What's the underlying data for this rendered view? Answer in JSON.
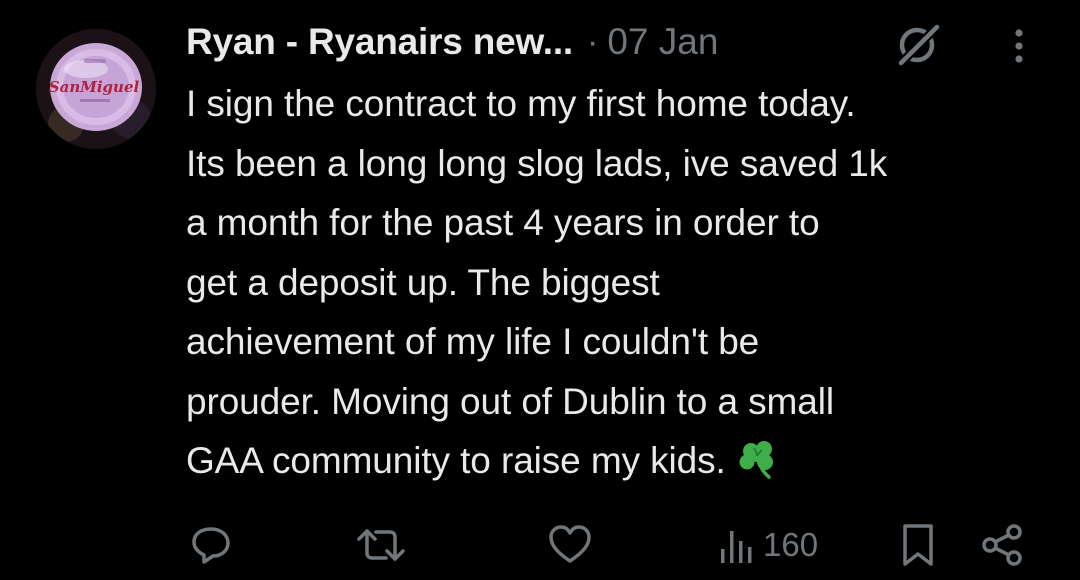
{
  "tweet": {
    "author_name": "Ryan - Ryanairs new...",
    "separator": "·",
    "timestamp": "07 Jan",
    "avatar_logo_text": "SanMiguel",
    "text_lines": [
      "I sign the contract to my first home today.",
      "Its been a long long slog lads, ive saved 1k",
      "a month for the past 4 years in order to",
      "get a deposit up. The biggest",
      "achievement of my life I couldn't be",
      "prouder. Moving out of Dublin to a small",
      "GAA community to raise my kids."
    ],
    "emoji": "shamrock"
  },
  "actions": {
    "reply_icon": "reply-icon",
    "retweet_icon": "retweet-icon",
    "like_icon": "heart-icon",
    "views_icon": "views-icon",
    "views_count": "160",
    "bookmark_icon": "bookmark-icon",
    "share_icon": "share-icon"
  },
  "colors": {
    "background": "#000000",
    "text_primary": "#e7e9ea",
    "text_secondary": "#71767b",
    "shamrock": "#3fae49"
  }
}
